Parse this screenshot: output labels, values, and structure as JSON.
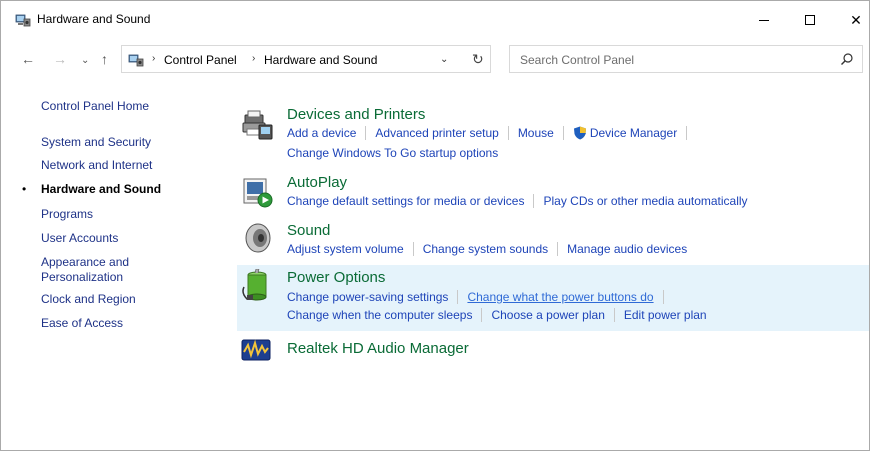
{
  "window": {
    "title": "Hardware and Sound",
    "minimize_glyph": "",
    "maximize_glyph": "",
    "close_glyph": "✕"
  },
  "nav": {
    "back_glyph": "←",
    "forward_glyph": "→",
    "recent_glyph": "⌄",
    "up_glyph": "↑",
    "breadcrumbs": [
      "Control Panel",
      "Hardware and Sound"
    ],
    "crumb_sep": "›",
    "dropdown_glyph": "⌄",
    "refresh_glyph": "↻",
    "search_placeholder": "Search Control Panel"
  },
  "leftnav": {
    "home": "Control Panel Home",
    "items": [
      {
        "label": "System and Security"
      },
      {
        "label": "Network and Internet"
      },
      {
        "label": "Hardware and Sound",
        "current": true
      },
      {
        "label": "Programs"
      },
      {
        "label": "User Accounts"
      },
      {
        "label": "Appearance and"
      },
      {
        "label": "Personalization"
      },
      {
        "label": "Clock and Region"
      },
      {
        "label": "Ease of Access"
      }
    ],
    "bullet": "•"
  },
  "categories": {
    "devices": {
      "title": "Devices and Printers",
      "icon": "printer-icon",
      "links_row1": [
        "Add a device",
        "Advanced printer setup",
        "Mouse",
        "Device Manager"
      ],
      "links_row2": [
        "Change Windows To Go startup options"
      ]
    },
    "autoplay": {
      "title": "AutoPlay",
      "icon": "autoplay-icon",
      "links_row1": [
        "Change default settings for media or devices",
        "Play CDs or other media automatically"
      ]
    },
    "sound": {
      "title": "Sound",
      "icon": "speaker-icon",
      "links_row1": [
        "Adjust system volume",
        "Change system sounds",
        "Manage audio devices"
      ]
    },
    "power": {
      "title": "Power Options",
      "icon": "battery-icon",
      "links_row1": [
        "Change power-saving settings",
        "Change what the power buttons do"
      ],
      "links_row2": [
        "Change when the computer sleeps",
        "Choose a power plan",
        "Edit power plan"
      ]
    },
    "realtek": {
      "title": "Realtek HD Audio Manager",
      "icon": "realtek-icon"
    }
  },
  "colors": {
    "category_title": "#0a6b36",
    "link": "#1e44b8",
    "highlight_bg": "#e5f3fb",
    "nav_link": "#1e3287"
  }
}
